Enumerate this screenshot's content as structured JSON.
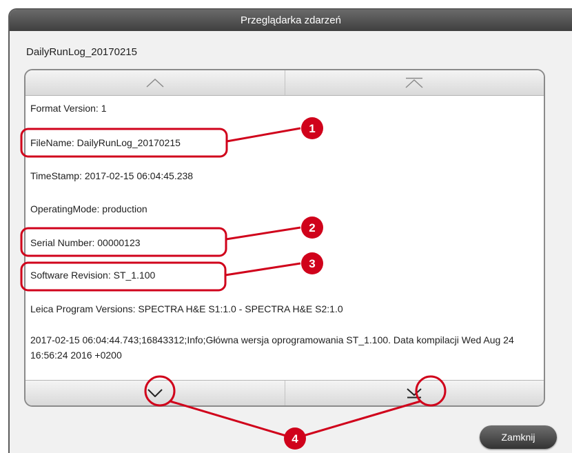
{
  "window": {
    "title": "Przeglądarka zdarzeń"
  },
  "file": {
    "name": "DailyRunLog_20170215"
  },
  "nav": {
    "up_icon": "chevron-up-icon",
    "top_icon": "jump-to-top-icon",
    "down_icon": "chevron-down-icon",
    "bottom_icon": "jump-to-bottom-icon"
  },
  "log": {
    "lines": [
      "Format Version: 1",
      "FileName: DailyRunLog_20170215",
      "TimeStamp: 2017-02-15 06:04:45.238",
      "OperatingMode: production",
      "Serial Number: 00000123",
      "Software Revision: ST_1.100",
      "Leica Program Versions: SPECTRA H&E S1:1.0 - SPECTRA H&E S2:1.0",
      "2017-02-15 06:04:44.743;16843312;Info;Główna wersja oprogramowania ST_1.100. Data kompilacji Wed Aug 24 16:56:24 2016 +0200"
    ]
  },
  "buttons": {
    "close_label": "Zamknij"
  },
  "callouts": {
    "labels": [
      "1",
      "2",
      "3",
      "4"
    ],
    "color": "#d0021b"
  }
}
